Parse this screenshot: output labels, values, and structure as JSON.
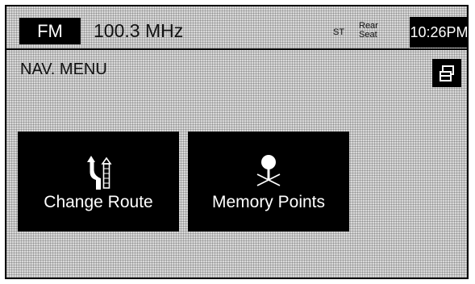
{
  "radio": {
    "band": "FM",
    "frequency": "100.3 MHz",
    "stereo": "ST",
    "rear_line1": "Rear",
    "rear_line2": "Seat",
    "clock": "10:26PM"
  },
  "nav": {
    "title": "NAV. MENU",
    "map_button_icon": "map-screen-icon"
  },
  "buttons": [
    {
      "label": "Change Route",
      "icon": "route-change-icon"
    },
    {
      "label": "Memory Points",
      "icon": "memory-point-icon"
    }
  ],
  "colors": {
    "background": "#d9d9d9",
    "button": "#000000",
    "button_text": "#ffffff"
  }
}
